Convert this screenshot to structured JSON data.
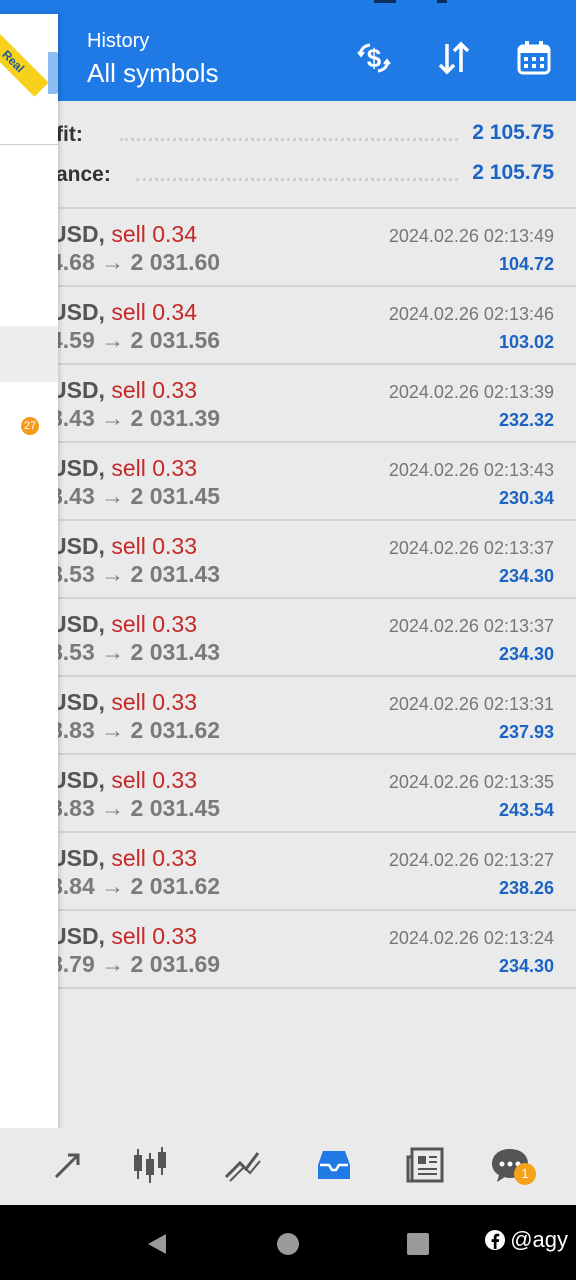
{
  "header": {
    "title": "History",
    "subtitle": "All symbols"
  },
  "summary": [
    {
      "label": "fit:",
      "value": "2 105.75"
    },
    {
      "label": "ance:",
      "value": "2 105.75"
    }
  ],
  "trades": [
    {
      "symbol": "USD,",
      "side": "sell 0.34",
      "prices": "4.68 → 2 031.60",
      "time": "2024.02.26 02:13:49",
      "profit": "104.72"
    },
    {
      "symbol": "USD,",
      "side": "sell 0.34",
      "prices": "4.59 → 2 031.56",
      "time": "2024.02.26 02:13:46",
      "profit": "103.02"
    },
    {
      "symbol": "USD,",
      "side": "sell 0.33",
      "prices": "8.43 → 2 031.39",
      "time": "2024.02.26 02:13:39",
      "profit": "232.32"
    },
    {
      "symbol": "USD,",
      "side": "sell 0.33",
      "prices": "8.43 → 2 031.45",
      "time": "2024.02.26 02:13:43",
      "profit": "230.34"
    },
    {
      "symbol": "USD,",
      "side": "sell 0.33",
      "prices": "8.53 → 2 031.43",
      "time": "2024.02.26 02:13:37",
      "profit": "234.30"
    },
    {
      "symbol": "USD,",
      "side": "sell 0.33",
      "prices": "8.53 → 2 031.43",
      "time": "2024.02.26 02:13:37",
      "profit": "234.30"
    },
    {
      "symbol": "USD,",
      "side": "sell 0.33",
      "prices": "8.83 → 2 031.62",
      "time": "2024.02.26 02:13:31",
      "profit": "237.93"
    },
    {
      "symbol": "USD,",
      "side": "sell 0.33",
      "prices": "8.83 → 2 031.45",
      "time": "2024.02.26 02:13:35",
      "profit": "243.54"
    },
    {
      "symbol": "USD,",
      "side": "sell 0.33",
      "prices": "8.84 → 2 031.62",
      "time": "2024.02.26 02:13:27",
      "profit": "238.26"
    },
    {
      "symbol": "USD,",
      "side": "sell 0.33",
      "prices": "8.79 → 2 031.69",
      "time": "2024.02.26 02:13:24",
      "profit": "234.30"
    }
  ],
  "drawer": {
    "ribbon": "Real",
    "badge": "27"
  },
  "bottom_tabs": {
    "items": [
      "quotes-icon",
      "chart-icon",
      "trade-icon",
      "history-icon",
      "news-icon",
      "chat-icon"
    ],
    "active": "history-icon",
    "chat_badge": "1"
  },
  "watermark": "@agy",
  "colors": {
    "accent": "#1f7ae6",
    "sell": "#c62828",
    "profit": "#1b63c4",
    "badge": "#f59a1b"
  }
}
